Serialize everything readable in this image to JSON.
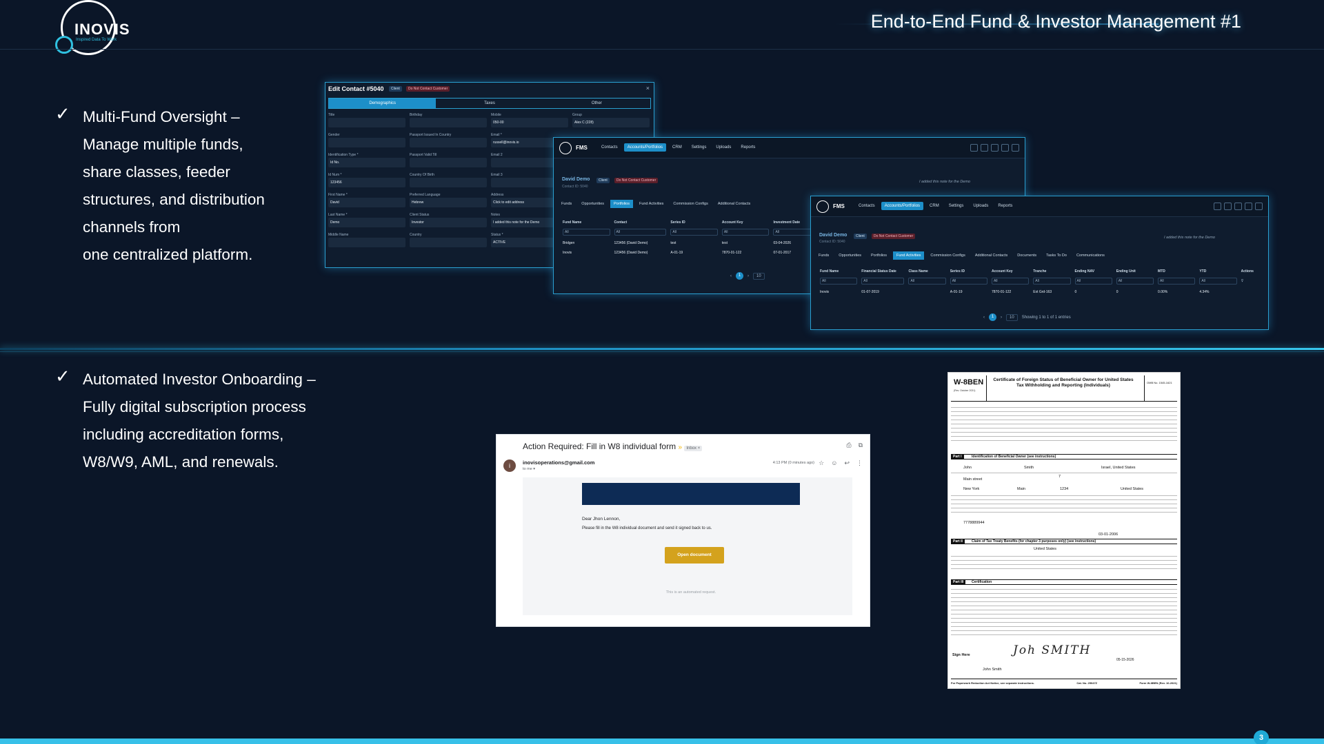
{
  "header": {
    "logo_text": "INOVIS",
    "logo_tagline": "Inspired Data To Work",
    "title": "End-to-End Fund & Investor Management #1"
  },
  "bullets": [
    {
      "check": "✓",
      "lines": [
        "Multi-Fund Oversight –",
        "Manage multiple funds,",
        "share classes, feeder",
        "structures, and distribution",
        "channels from",
        "one centralized platform."
      ]
    },
    {
      "check": "✓",
      "lines": [
        "Automated Investor Onboarding –",
        "Fully digital subscription process",
        "including accreditation forms,",
        "W8/W9, AML, and renewals."
      ]
    }
  ],
  "edit_contact": {
    "title": "Edit Contact #5040",
    "badge_client": "Client",
    "badge_dnc": "Do Not Contact Customer",
    "close": "×",
    "tabs": [
      "Demographics",
      "Taxes",
      "Other"
    ],
    "col1": [
      {
        "label": "Title",
        "value": ""
      },
      {
        "label": "Gender",
        "value": ""
      },
      {
        "label": "Identification Type *",
        "value": "Id No."
      },
      {
        "label": "Id Num *",
        "value": "123456"
      },
      {
        "label": "First Name *",
        "value": "David"
      },
      {
        "label": "Last Name *",
        "value": "Demo"
      },
      {
        "label": "Middle Name",
        "value": ""
      }
    ],
    "col2": [
      {
        "label": "Birthday",
        "value": ""
      },
      {
        "label": "Passport Issued In Country",
        "value": ""
      },
      {
        "label": "Passport Valid Till",
        "value": ""
      },
      {
        "label": "Country Of Birth",
        "value": ""
      },
      {
        "label": "Preferred Language",
        "value": "Hebrew"
      },
      {
        "label": "Client Status",
        "value": "Investor"
      },
      {
        "label": "Country",
        "value": ""
      }
    ],
    "col3": [
      {
        "label": "Mobile",
        "value": "050-00"
      },
      {
        "label": "Email *",
        "value": "russell@inovis.io"
      },
      {
        "label": "Email 2",
        "value": ""
      },
      {
        "label": "Email 3",
        "value": ""
      },
      {
        "label": "Address",
        "value": "Click to edit address"
      },
      {
        "label": "Notes",
        "value": "I added this note for the Demo"
      },
      {
        "label": "Status *",
        "value": "ACTIVE"
      }
    ],
    "group_label": "Group",
    "group_value": "Alex C (228)"
  },
  "fms1": {
    "app_name": "FMS",
    "nav": [
      "Contacts",
      "Accounts/Portfolios",
      "CRM",
      "Settings",
      "Uploads",
      "Reports"
    ],
    "contact_name": "David Demo",
    "badge_client": "Client",
    "badge_dnc": "Do Not Contact Customer",
    "contact_id": "Contact ID: 5040",
    "note": "I added this note for the Demo",
    "subtabs": [
      "Funds",
      "Opportunities",
      "Portfolios",
      "Fund Activities",
      "Commission Configs",
      "Additional Contacts"
    ],
    "columns": [
      "Fund Name",
      "Contact",
      "Series ID",
      "Account Key",
      "Investment Date"
    ],
    "filter": "All",
    "rows": [
      [
        "Bridgen",
        "123456 (David Demo)",
        "test",
        "test",
        "03-04-2026"
      ],
      [
        "Inovis",
        "123456 (David Demo)",
        "A-01-19",
        "7870-01-122",
        "07-01-2017"
      ]
    ],
    "page": "1",
    "page_size": "10"
  },
  "fms2": {
    "app_name": "FMS",
    "nav": [
      "Contacts",
      "Accounts/Portfolios",
      "CRM",
      "Settings",
      "Uploads",
      "Reports"
    ],
    "contact_name": "David Demo",
    "badge_client": "Client",
    "badge_dnc": "Do Not Contact Customer",
    "contact_id": "Contact ID: 5040",
    "note": "I added this note for the Demo",
    "subtabs": [
      "Funds",
      "Opportunities",
      "Portfolios",
      "Fund Activities",
      "Commission Configs",
      "Additional Contacts",
      "Documents",
      "Tasks To Do",
      "Communications"
    ],
    "columns": [
      "Fund Name",
      "Financial Status Date",
      "Class Name",
      "Series ID",
      "Account Key",
      "Tranche",
      "Ending NAV",
      "Ending Unit",
      "MTD",
      "YTD",
      "Actions"
    ],
    "filter": "All",
    "row": [
      "Inovis",
      "01-07-2019",
      "",
      "A-01-19",
      "7870-01-122",
      "Ext Grd-163",
      "0",
      "0",
      "0.00%",
      "4.34%"
    ],
    "page": "1",
    "page_size": "10",
    "showing": "Showing 1 to 1 of 1 entries"
  },
  "email": {
    "subject": "Action Required: Fill in W8 individual form",
    "label": "Inbox ×",
    "sender_initial": "i",
    "from": "inovisoperations@gmail.com",
    "to": "to me ▾",
    "time": "4:13 PM (0 minutes ago)",
    "greeting": "Dear Jhon Lennon,",
    "message": "Please fill in the W8 individual document and send it signed back to us.",
    "button": "Open document",
    "auto_note": "This is an automated request."
  },
  "form": {
    "form_no": "W-8BEN",
    "form_date": "(Rev. October 2021)",
    "title": "Certificate of Foreign Status of Beneficial Owner for United States Tax Withholding and Reporting (Individuals)",
    "omb": "OMB No. 1545-1621",
    "part1_tag": "Part I",
    "part1_name": "Identification of Beneficial Owner (see instructions)",
    "part2_tag": "Part II",
    "part2_name": "Claim of Tax Treaty Benefits (for chapter 3 purposes only) (see instructions)",
    "part3_tag": "Part III",
    "part3_name": "Certification",
    "name_first": "John",
    "name_last": "Smith",
    "citizenship": "Israel, United States",
    "street": "Main street",
    "street_no": "7",
    "city": "New York",
    "city_2": "Main",
    "zip": "1234",
    "country": "United States",
    "ftin": "7778889944",
    "dob": "03-01-2006",
    "treaty_country": "United States",
    "sign_label": "Sign Here",
    "signature": "Joh SMITH",
    "signed_name": "John Smith",
    "sign_date": "05-15-2026",
    "footer_left": "For Paperwork Reduction Act Notice, see separate instructions.",
    "footer_mid": "Cat. No. 25047Z",
    "footer_right": "Form W-8BEN (Rev. 10-2021)"
  },
  "page_number": "3"
}
